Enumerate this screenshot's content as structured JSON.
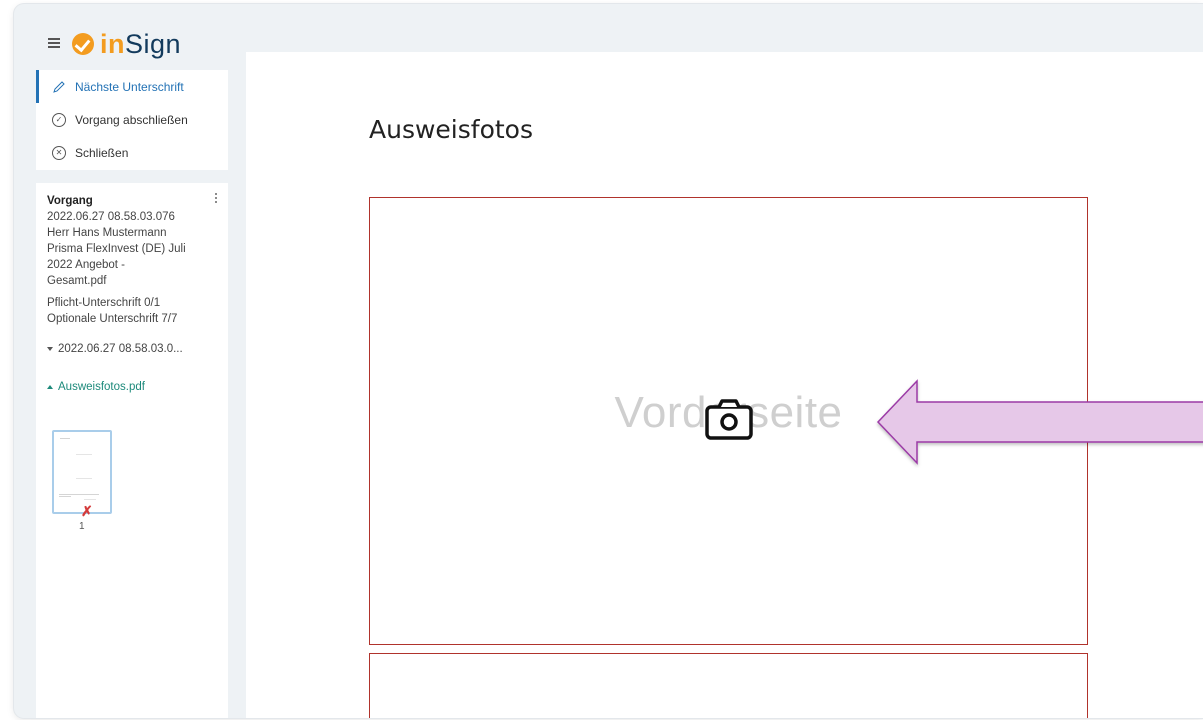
{
  "app": {
    "logo_in": "in",
    "logo_sign": "Sign",
    "brand_color": "#f39c1f"
  },
  "menu": {
    "items": [
      {
        "label": "Nächste Unterschrift",
        "icon": "pen-icon",
        "active": true
      },
      {
        "label": "Vorgang abschließen",
        "icon": "check-circle-icon",
        "active": false
      },
      {
        "label": "Schließen",
        "icon": "close-circle-icon",
        "active": false
      }
    ]
  },
  "process": {
    "title": "Vorgang",
    "details": "2022.06.27 08.58.03.076\nHerr Hans Mustermann\nPrisma FlexInvest (DE) Juli\n2022 Angebot -\nGesamt.pdf",
    "signatures": "Pflicht-Unterschrift 0/1\nOptionale Unterschrift 7/7",
    "tree_item": "2022.06.27 08.58.03.0...",
    "document": "Ausweisfotos.pdf",
    "page_number": "1"
  },
  "main": {
    "title": "Ausweisfotos",
    "placeholder": "Vorderseite"
  },
  "colors": {
    "accent_blue": "#2372b5",
    "link_green": "#1d8a7b",
    "frame_red": "#b0332c",
    "arrow_fill": "#e6c8e8",
    "arrow_stroke": "#9b3aa6"
  }
}
